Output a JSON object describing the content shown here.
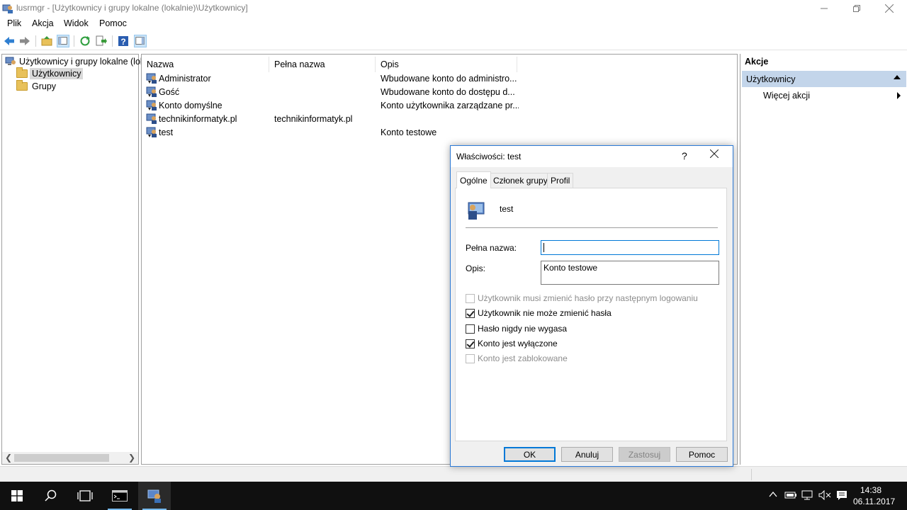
{
  "window": {
    "title": "lusrmgr - [Użytkownicy i grupy lokalne (lokalnie)\\Użytkownicy]"
  },
  "menu": [
    "Plik",
    "Akcja",
    "Widok",
    "Pomoc"
  ],
  "tree": {
    "root": "Użytkownicy i grupy lokalne (lok",
    "items": [
      "Użytkownicy",
      "Grupy"
    ]
  },
  "list": {
    "headers": [
      "Nazwa",
      "Pełna nazwa",
      "Opis"
    ],
    "rows": [
      {
        "name": "Administrator",
        "full": "",
        "desc": "Wbudowane konto do administro..."
      },
      {
        "name": "Gość",
        "full": "",
        "desc": "Wbudowane konto do dostępu d..."
      },
      {
        "name": "Konto domyślne",
        "full": "",
        "desc": "Konto użytkownika zarządzane pr..."
      },
      {
        "name": "technikinformatyk.pl",
        "full": "technikinformatyk.pl",
        "desc": ""
      },
      {
        "name": "test",
        "full": "",
        "desc": "Konto testowe"
      }
    ]
  },
  "actions": {
    "title": "Akcje",
    "section": "Użytkownicy",
    "more": "Więcej akcji"
  },
  "dialog": {
    "title": "Właściwości: test",
    "help": "?",
    "tabs": [
      "Ogólne",
      "Członek grupy",
      "Profil"
    ],
    "username": "test",
    "full_name_label": "Pełna nazwa:",
    "full_name_value": "",
    "desc_label": "Opis:",
    "desc_value": "Konto testowe",
    "checkboxes": [
      {
        "label": "Użytkownik musi zmienić hasło przy następnym logowaniu",
        "checked": false,
        "disabled": true
      },
      {
        "label": "Użytkownik nie może zmienić hasła",
        "checked": true,
        "disabled": false
      },
      {
        "label": "Hasło nigdy nie wygasa",
        "checked": false,
        "disabled": false
      },
      {
        "label": "Konto jest wyłączone",
        "checked": true,
        "disabled": false
      },
      {
        "label": "Konto jest zablokowane",
        "checked": false,
        "disabled": true
      }
    ],
    "buttons": {
      "ok": "OK",
      "cancel": "Anuluj",
      "apply": "Zastosuj",
      "help": "Pomoc"
    }
  },
  "taskbar": {
    "time": "14:38",
    "date": "06.11.2017"
  },
  "icons": {
    "window": [
      "app-icon",
      "minimize-icon",
      "maximize-icon",
      "close-icon"
    ],
    "toolbar": [
      "back-icon",
      "forward-icon",
      "up-folder-icon",
      "show-hide-tree-icon",
      "refresh-icon",
      "export-list-icon",
      "help-icon",
      "show-hide-action-pane-icon"
    ],
    "taskbar": [
      "windows-start-icon",
      "search-icon",
      "task-view-icon",
      "cmd-icon",
      "lusrmgr-icon"
    ],
    "tray": [
      "chevron-up-icon",
      "battery-icon",
      "network-icon",
      "volume-muted-icon",
      "notifications-icon"
    ]
  },
  "colors": {
    "selection": "#c3d5ea",
    "accent": "#0078d7",
    "taskbar": "#101010"
  }
}
